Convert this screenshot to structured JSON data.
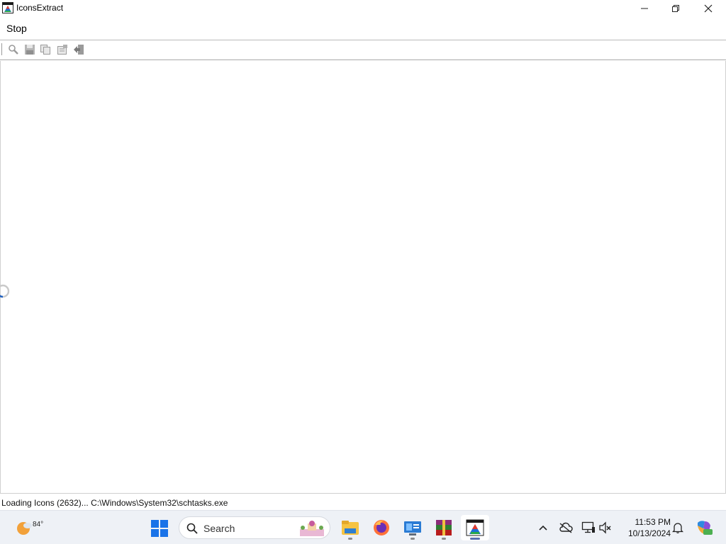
{
  "window": {
    "title": "IconsExtract",
    "minimize_icon": "minimize-icon",
    "maximize_icon": "restore-icon",
    "close_icon": "close-icon"
  },
  "menu": {
    "items": [
      {
        "label": "Stop"
      }
    ]
  },
  "toolbar": {
    "buttons": [
      "find-icon",
      "save-icon",
      "copy-icon",
      "properties-icon",
      "exit-icon"
    ]
  },
  "main": {
    "loading_indicator": "spinner-icon"
  },
  "status": {
    "text": "Loading Icons (2632)... C:\\Windows\\System32\\schtasks.exe"
  },
  "taskbar": {
    "weather_temp": "84°",
    "search_placeholder": "Search",
    "apps": [
      "file-explorer-icon",
      "firefox-icon",
      "control-panel-icon",
      "winrar-icon",
      "iconsextract-icon"
    ],
    "tray": [
      "chevron-up-icon",
      "onedrive-offline-icon",
      "network-icon",
      "volume-muted-icon",
      "notifications-icon",
      "copilot-icon"
    ],
    "time": "11:53 PM",
    "date": "10/13/2024"
  },
  "colors": {
    "taskbar_bg": "#eef1f6",
    "active_indicator": "#5a6fb0",
    "windows_blue": "#1a73e8"
  }
}
